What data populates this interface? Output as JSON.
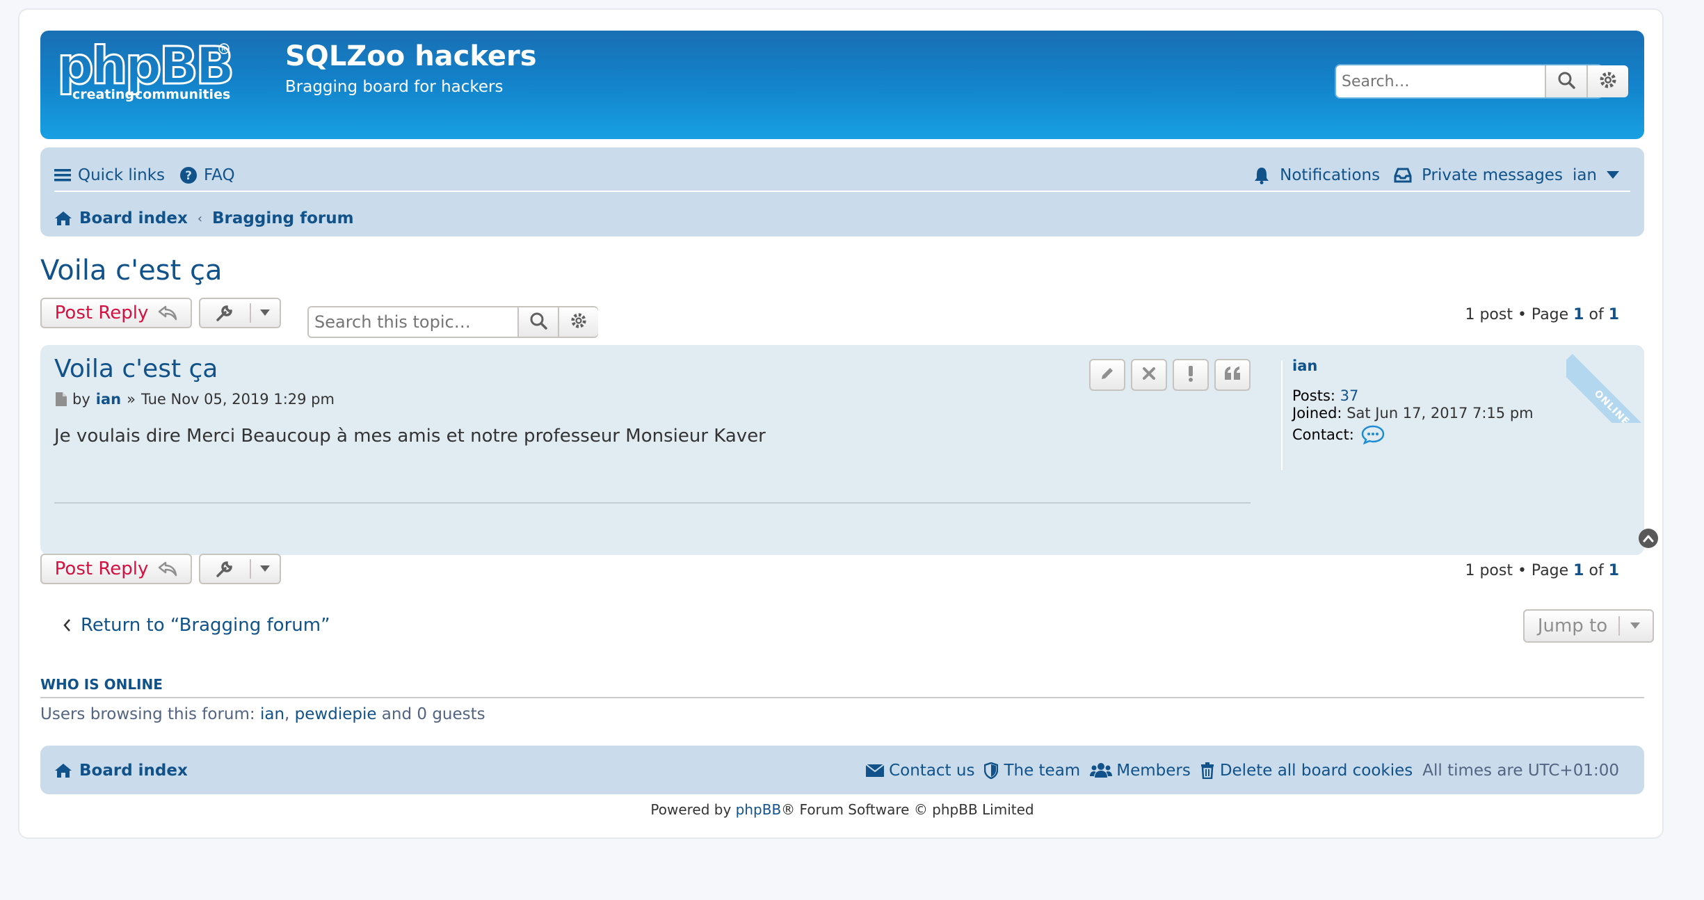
{
  "header": {
    "logo_text": "phpBB",
    "logo_tagline_left": "creating",
    "logo_tagline_right": "communities",
    "site_title": "SQLZoo hackers",
    "site_description": "Bragging board for hackers",
    "search_placeholder": "Search…"
  },
  "navbar": {
    "quick_links": "Quick links",
    "faq": "FAQ",
    "notifications": "Notifications",
    "private_messages": "Private messages",
    "username": "ian",
    "breadcrumbs": [
      "Board index",
      "Bragging forum"
    ]
  },
  "topic": {
    "title": "Voila c'est ça",
    "post_reply": "Post Reply",
    "search_placeholder": "Search this topic…",
    "pagination": {
      "count_text": "1 post • Page ",
      "page": "1",
      "of_text": " of ",
      "total": "1"
    }
  },
  "post": {
    "title": "Voila c'est ça",
    "by_label": "by",
    "author": "ian",
    "sep": "»",
    "datetime": "Tue Nov 05, 2019 1:29 pm",
    "content": "Je voulais dire Merci Beaucoup à mes amis et notre professeur Monsieur Kaver",
    "profile": {
      "username": "ian",
      "posts_label": "Posts:",
      "posts_value": "37",
      "joined_label": "Joined:",
      "joined_value": "Sat Jun 17, 2017 7:15 pm",
      "contact_label": "Contact:"
    },
    "online_badge": "ONLINE"
  },
  "bottom": {
    "return_link": "Return to “Bragging forum”",
    "jump_to": "Jump to"
  },
  "who_is_online": {
    "title": "WHO IS ONLINE",
    "prefix": "Users browsing this forum: ",
    "user1": "ian",
    "comma": ", ",
    "user2": "pewdiepie",
    "suffix": " and 0 guests"
  },
  "footer": {
    "board_index": "Board index",
    "contact_us": "Contact us",
    "the_team": "The team",
    "members": "Members",
    "delete_cookies": "Delete all board cookies",
    "timezone": "All times are UTC+01:00",
    "powered_prefix": "Powered by ",
    "powered_link": "phpBB",
    "powered_suffix": "® Forum Software © phpBB Limited"
  },
  "colors": {
    "header_gradient_top": "#1a6fb3",
    "header_gradient_bottom": "#18a0e3",
    "navbar_bg": "#cadceb",
    "post_bg": "#e1ebf2",
    "link": "#105289",
    "reply_red": "#d31141"
  }
}
